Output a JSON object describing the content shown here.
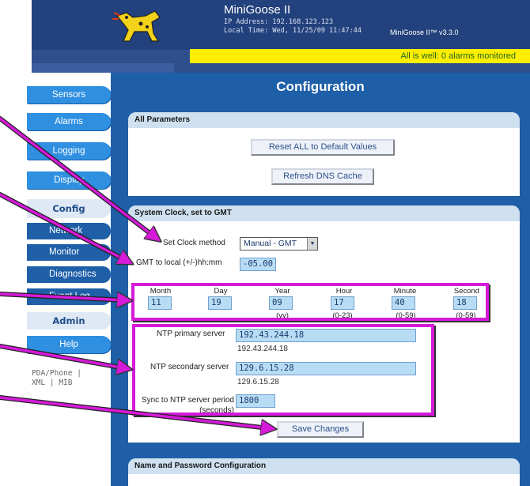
{
  "header": {
    "title": "MiniGoose II",
    "ip_line": "IP Address: 192.168.123.123",
    "time_line": "Local Time: Wed, 11/25/09 11:47:44",
    "version": "MiniGoose II™ v3.3.0",
    "status": "All is well: 0 alarms monitored"
  },
  "sidebar": {
    "items": [
      {
        "label": "Sensors"
      },
      {
        "label": "Alarms"
      },
      {
        "label": "Logging"
      },
      {
        "label": "Display"
      },
      {
        "label": "Config"
      },
      {
        "label": "Network"
      },
      {
        "label": "Monitor"
      },
      {
        "label": "Diagnostics"
      },
      {
        "label": "Event Log"
      },
      {
        "label": "Admin"
      },
      {
        "label": "Help"
      }
    ],
    "pda_line1": "PDA/Phone |",
    "pda_line2": "XML | MIB"
  },
  "main": {
    "page_title": "Configuration",
    "all_params": {
      "heading": "All Parameters",
      "reset_button": "Reset ALL to Default Values",
      "refresh_button": "Refresh DNS Cache"
    },
    "clock": {
      "heading": "System Clock, set to GMT",
      "method_label": "Set Clock method",
      "method_value": "Manual - GMT",
      "gmt_label": "GMT to local (+/-)hh:mm",
      "gmt_value": "-05.00",
      "cols": [
        {
          "label": "Month",
          "value": "11",
          "hint": ""
        },
        {
          "label": "Day",
          "value": "19",
          "hint": ""
        },
        {
          "label": "Year",
          "value": "09",
          "hint": "(yy)"
        },
        {
          "label": "Hour",
          "value": "17",
          "hint": "(0-23)"
        },
        {
          "label": "Minute",
          "value": "40",
          "hint": "(0-59)"
        },
        {
          "label": "Second",
          "value": "18",
          "hint": "(0-59)"
        }
      ],
      "ntp_primary_label": "NTP primary server",
      "ntp_primary_value": "192.43.244.18",
      "ntp_primary_resolved": "192.43.244.18",
      "ntp_secondary_label": "NTP secondary server",
      "ntp_secondary_value": "129.6.15.28",
      "ntp_secondary_resolved": "129.6.15.28",
      "sync_label_1": "Sync to NTP server period",
      "sync_label_2": "(seconds)",
      "sync_value": "1800",
      "save_button": "Save Changes"
    },
    "name_pw": {
      "heading": "Name and Password Configuration"
    }
  },
  "colors": {
    "nav_blue": "#2f8fe0",
    "main_blue": "#1e5fa8",
    "highlight_magenta": "#d51ad8",
    "status_yellow": "#ffee00"
  }
}
